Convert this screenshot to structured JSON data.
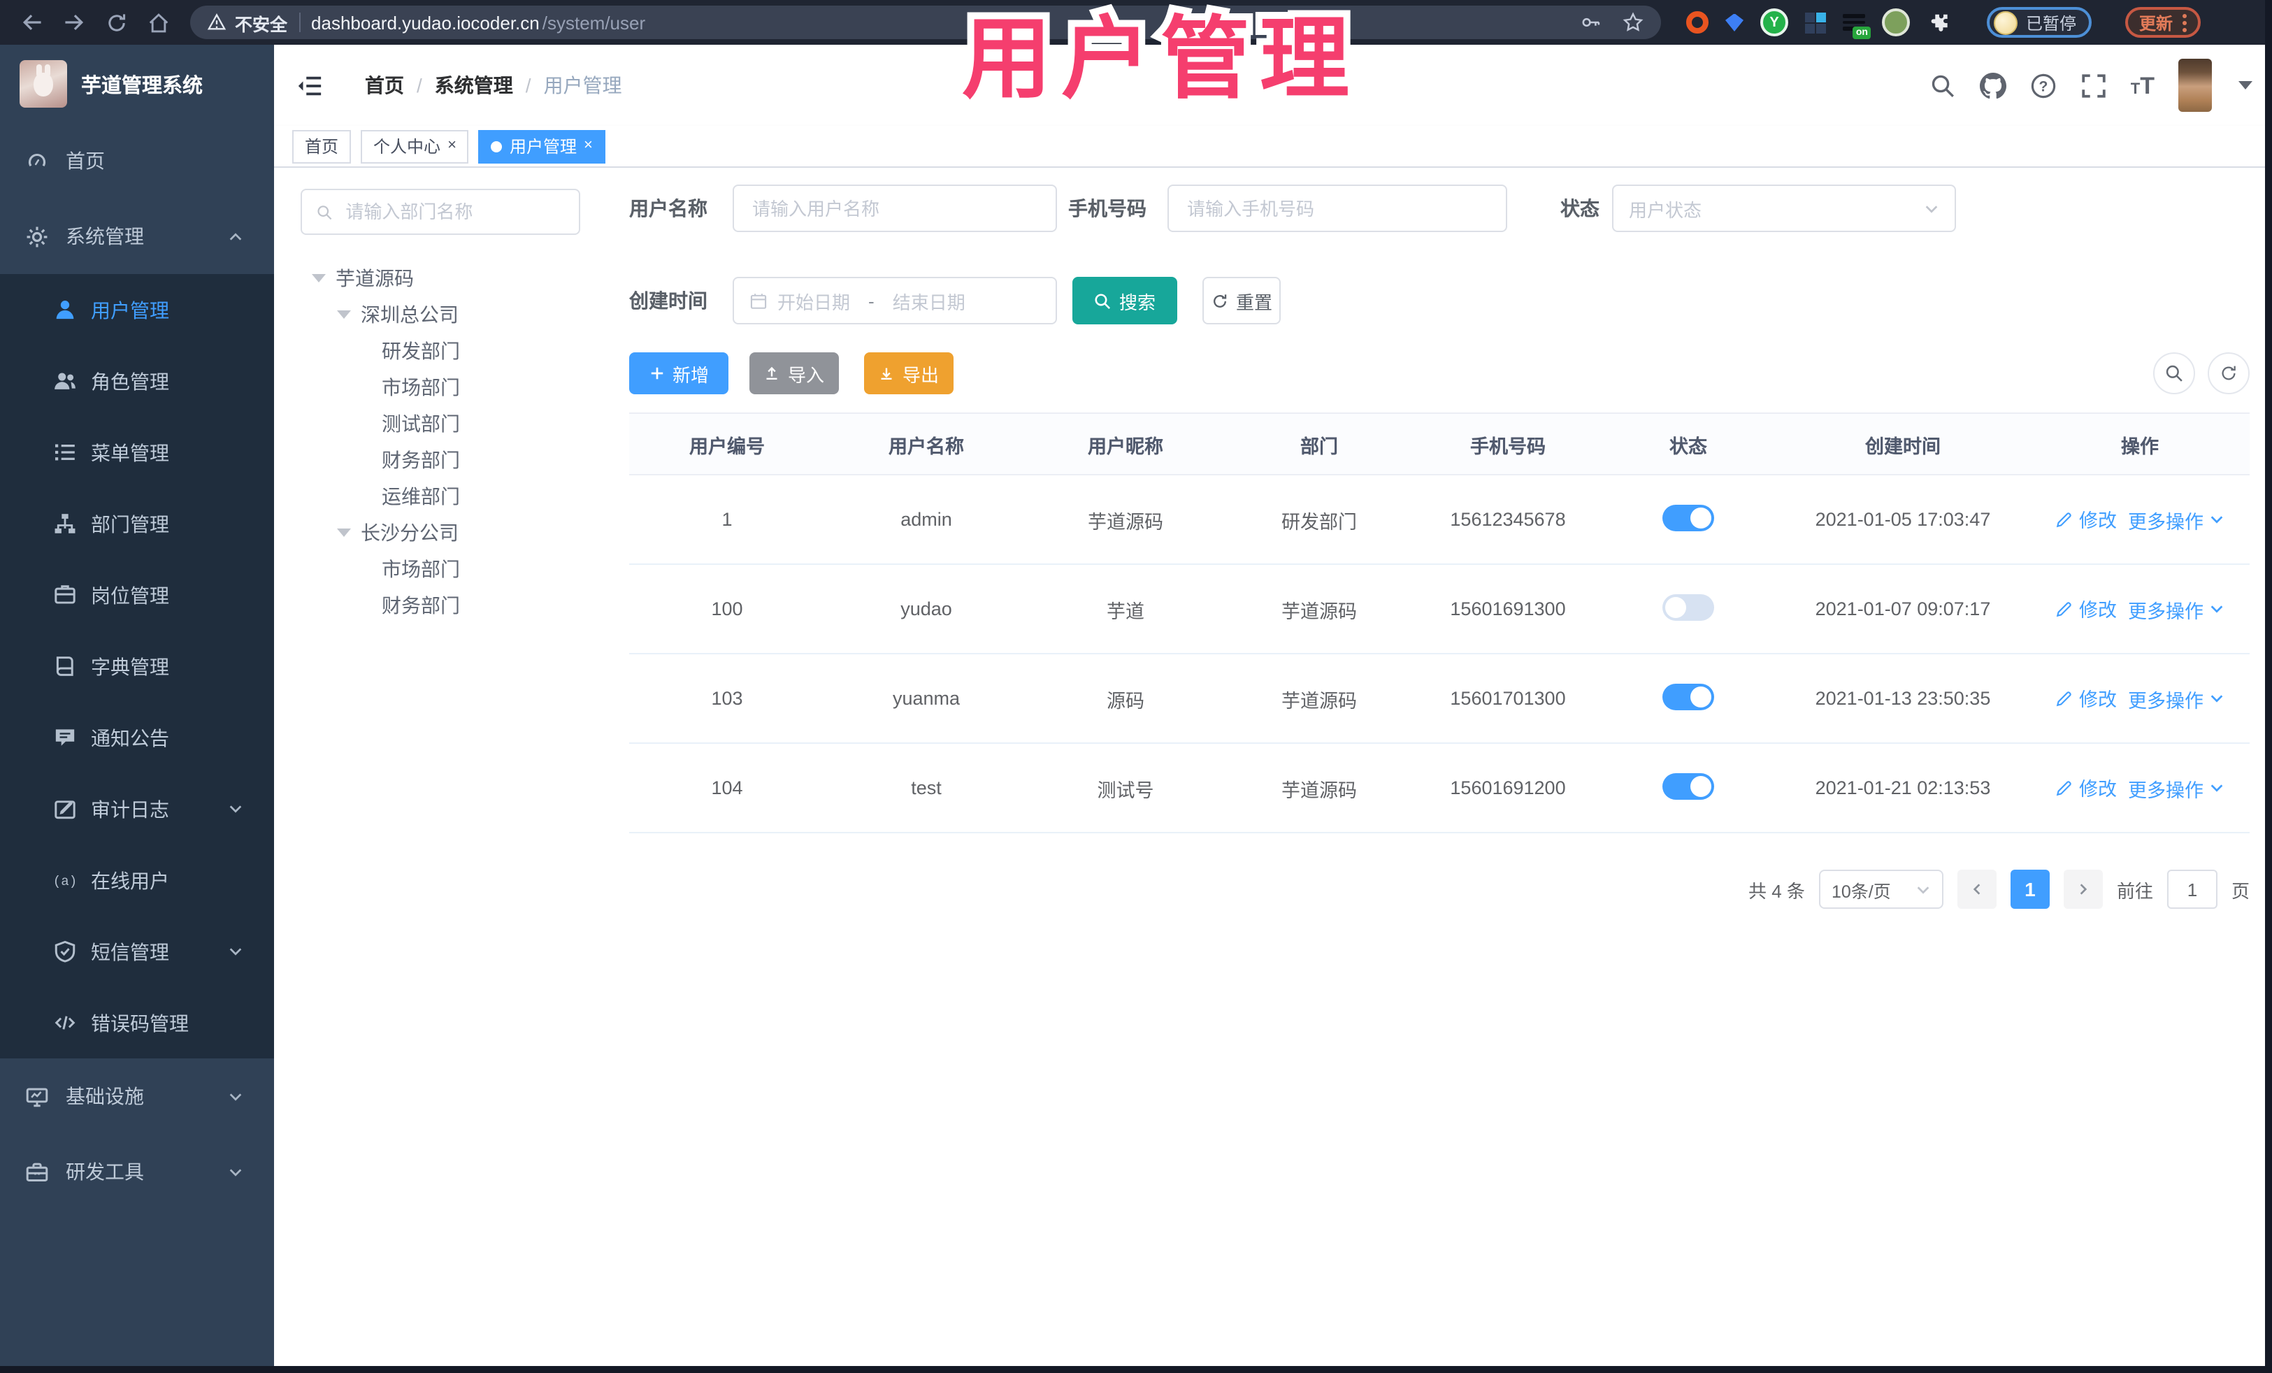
{
  "browser": {
    "security_label": "不安全",
    "host": "dashboard.yudao.iocoder.cn",
    "path": "/system/user",
    "paused_label": "已暂停",
    "update_label": "更新"
  },
  "overlay": {
    "title": "用户管理"
  },
  "header": {
    "breadcrumb": [
      "首页",
      "系统管理",
      "用户管理"
    ]
  },
  "tabs": [
    {
      "label": "首页",
      "closable": false,
      "active": false
    },
    {
      "label": "个人中心",
      "closable": true,
      "active": false
    },
    {
      "label": "用户管理",
      "closable": true,
      "active": true
    }
  ],
  "sidebar": {
    "logo_title": "芋道管理系统",
    "items": [
      {
        "label": "首页",
        "icon": "dashboard-icon"
      },
      {
        "label": "系统管理",
        "icon": "gear-icon",
        "arrow": "up",
        "children": [
          {
            "label": "用户管理",
            "icon": "user-icon",
            "active": true
          },
          {
            "label": "角色管理",
            "icon": "users-icon"
          },
          {
            "label": "菜单管理",
            "icon": "menu-list-icon"
          },
          {
            "label": "部门管理",
            "icon": "org-tree-icon"
          },
          {
            "label": "岗位管理",
            "icon": "badge-icon"
          },
          {
            "label": "字典管理",
            "icon": "book-icon"
          },
          {
            "label": "通知公告",
            "icon": "comment-icon"
          },
          {
            "label": "审计日志",
            "icon": "edit-log-icon",
            "arrow": "down"
          },
          {
            "label": "在线用户",
            "icon": "online-icon"
          },
          {
            "label": "短信管理",
            "icon": "shield-icon",
            "arrow": "down"
          },
          {
            "label": "错误码管理",
            "icon": "code-icon"
          }
        ]
      },
      {
        "label": "基础设施",
        "icon": "monitor-icon",
        "arrow": "down"
      },
      {
        "label": "研发工具",
        "icon": "toolbox-icon",
        "arrow": "down"
      }
    ]
  },
  "tree": {
    "search_placeholder": "请输入部门名称",
    "nodes": [
      {
        "label": "芋道源码",
        "depth": 0,
        "caret": true
      },
      {
        "label": "深圳总公司",
        "depth": 1,
        "caret": true
      },
      {
        "label": "研发部门",
        "depth": 2,
        "caret": false
      },
      {
        "label": "市场部门",
        "depth": 2,
        "caret": false
      },
      {
        "label": "测试部门",
        "depth": 2,
        "caret": false
      },
      {
        "label": "财务部门",
        "depth": 2,
        "caret": false
      },
      {
        "label": "运维部门",
        "depth": 2,
        "caret": false
      },
      {
        "label": "长沙分公司",
        "depth": 1,
        "caret": true
      },
      {
        "label": "市场部门",
        "depth": 2,
        "caret": false
      },
      {
        "label": "财务部门",
        "depth": 2,
        "caret": false
      }
    ]
  },
  "filters": {
    "username": {
      "label": "用户名称",
      "placeholder": "请输入用户名称"
    },
    "mobile": {
      "label": "手机号码",
      "placeholder": "请输入手机号码"
    },
    "status": {
      "label": "状态",
      "placeholder": "用户状态"
    },
    "create_time": {
      "label": "创建时间",
      "start": "开始日期",
      "sep": "-",
      "end": "结束日期"
    },
    "search_label": "搜索",
    "reset_label": "重置"
  },
  "toolbar": {
    "add": "新增",
    "import": "导入",
    "export": "导出"
  },
  "table": {
    "columns": [
      "用户编号",
      "用户名称",
      "用户昵称",
      "部门",
      "手机号码",
      "状态",
      "创建时间",
      "操作"
    ],
    "actions": {
      "edit": "修改",
      "more": "更多操作"
    },
    "rows": [
      {
        "id": "1",
        "username": "admin",
        "nickname": "芋道源码",
        "dept": "研发部门",
        "mobile": "15612345678",
        "status": true,
        "created": "2021-01-05 17:03:47"
      },
      {
        "id": "100",
        "username": "yudao",
        "nickname": "芋道",
        "dept": "芋道源码",
        "mobile": "15601691300",
        "status": false,
        "created": "2021-01-07 09:07:17"
      },
      {
        "id": "103",
        "username": "yuanma",
        "nickname": "源码",
        "dept": "芋道源码",
        "mobile": "15601701300",
        "status": true,
        "created": "2021-01-13 23:50:35"
      },
      {
        "id": "104",
        "username": "test",
        "nickname": "测试号",
        "dept": "芋道源码",
        "mobile": "15601691200",
        "status": true,
        "created": "2021-01-21 02:13:53"
      }
    ]
  },
  "pagination": {
    "total": "共 4 条",
    "page_size": "10条/页",
    "current": "1",
    "goto_label": "前往",
    "goto_value": "1",
    "unit": "页"
  },
  "colors": {
    "primary": "#409eff",
    "sidebar_bg": "#304156",
    "submenu_bg": "#1f2d3d",
    "search_button": "#17a79a",
    "export_button": "#efa12f",
    "import_button": "#909399",
    "annotation_pink": "#f53e6e"
  }
}
